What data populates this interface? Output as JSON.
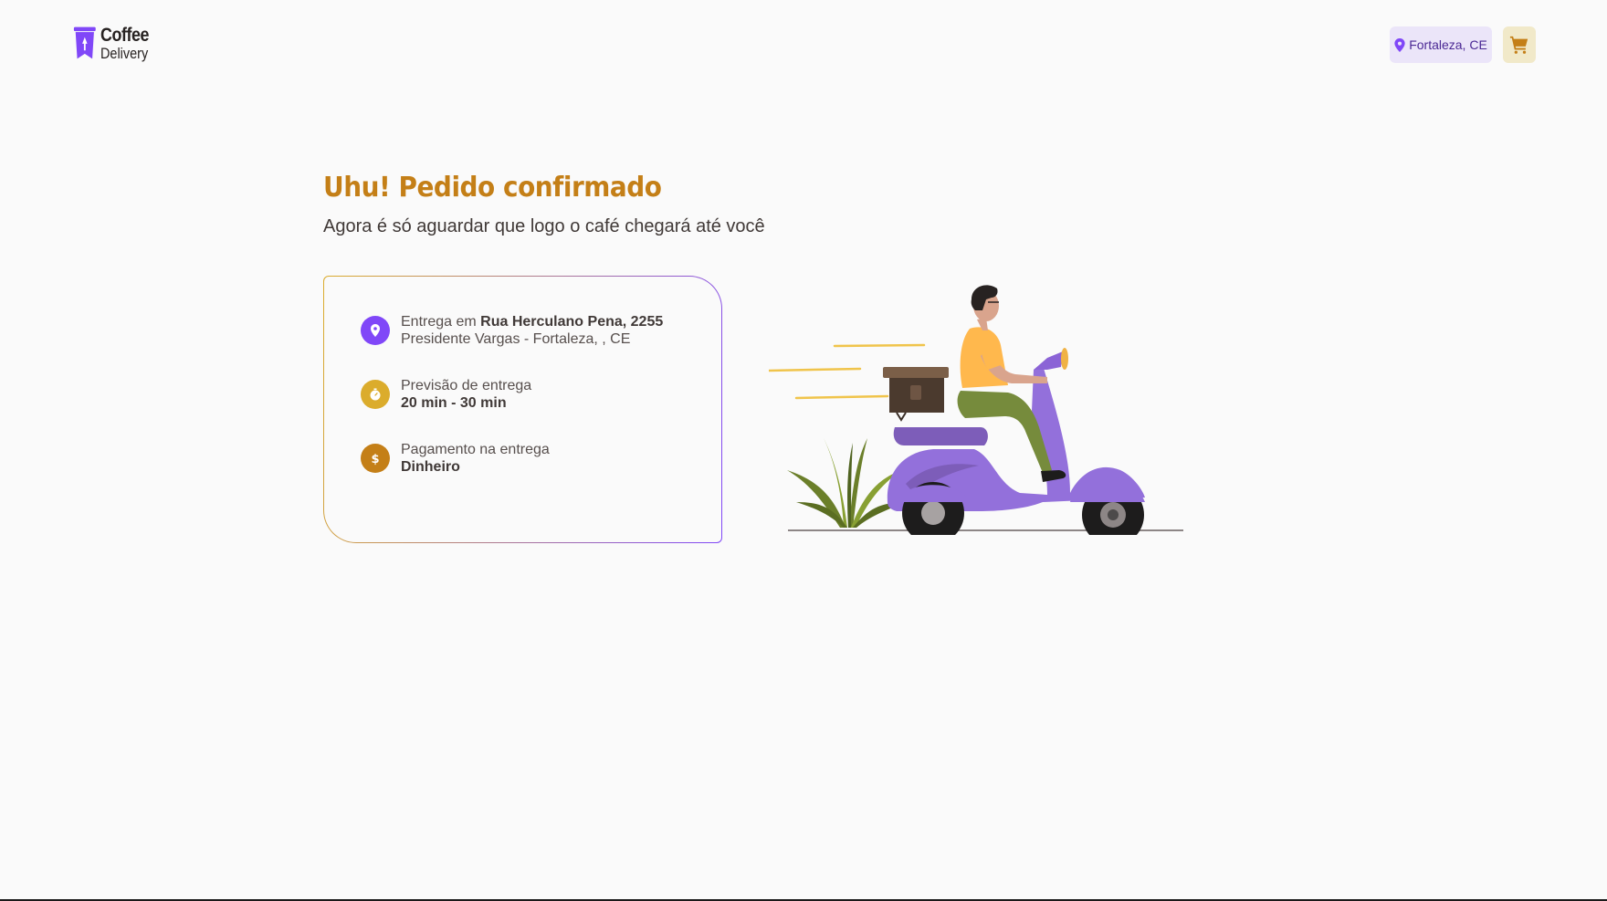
{
  "header": {
    "logo_line1": "Coffee",
    "logo_line2": "Delivery",
    "location": "Fortaleza, CE",
    "cart_icon": "shopping-cart-icon"
  },
  "main": {
    "title": "Uhu! Pedido confirmado",
    "subtitle": "Agora é só aguardar que logo o café chegará até você",
    "delivery": {
      "prefix": "Entrega em ",
      "street": "Rua Herculano Pena, 2255",
      "district": "Presidente Vargas - Fortaleza, , CE"
    },
    "forecast": {
      "label": "Previsão de entrega",
      "value": "20 min - 30 min"
    },
    "payment": {
      "label": "Pagamento na entrega",
      "value": "Dinheiro"
    }
  },
  "colors": {
    "yellow_dark": "#C47F17",
    "yellow": "#DBAC2C",
    "purple": "#8047F8",
    "purple_dark": "#4B2995",
    "purple_light": "#EBE5F9",
    "yellow_light": "#F1E9C9"
  }
}
